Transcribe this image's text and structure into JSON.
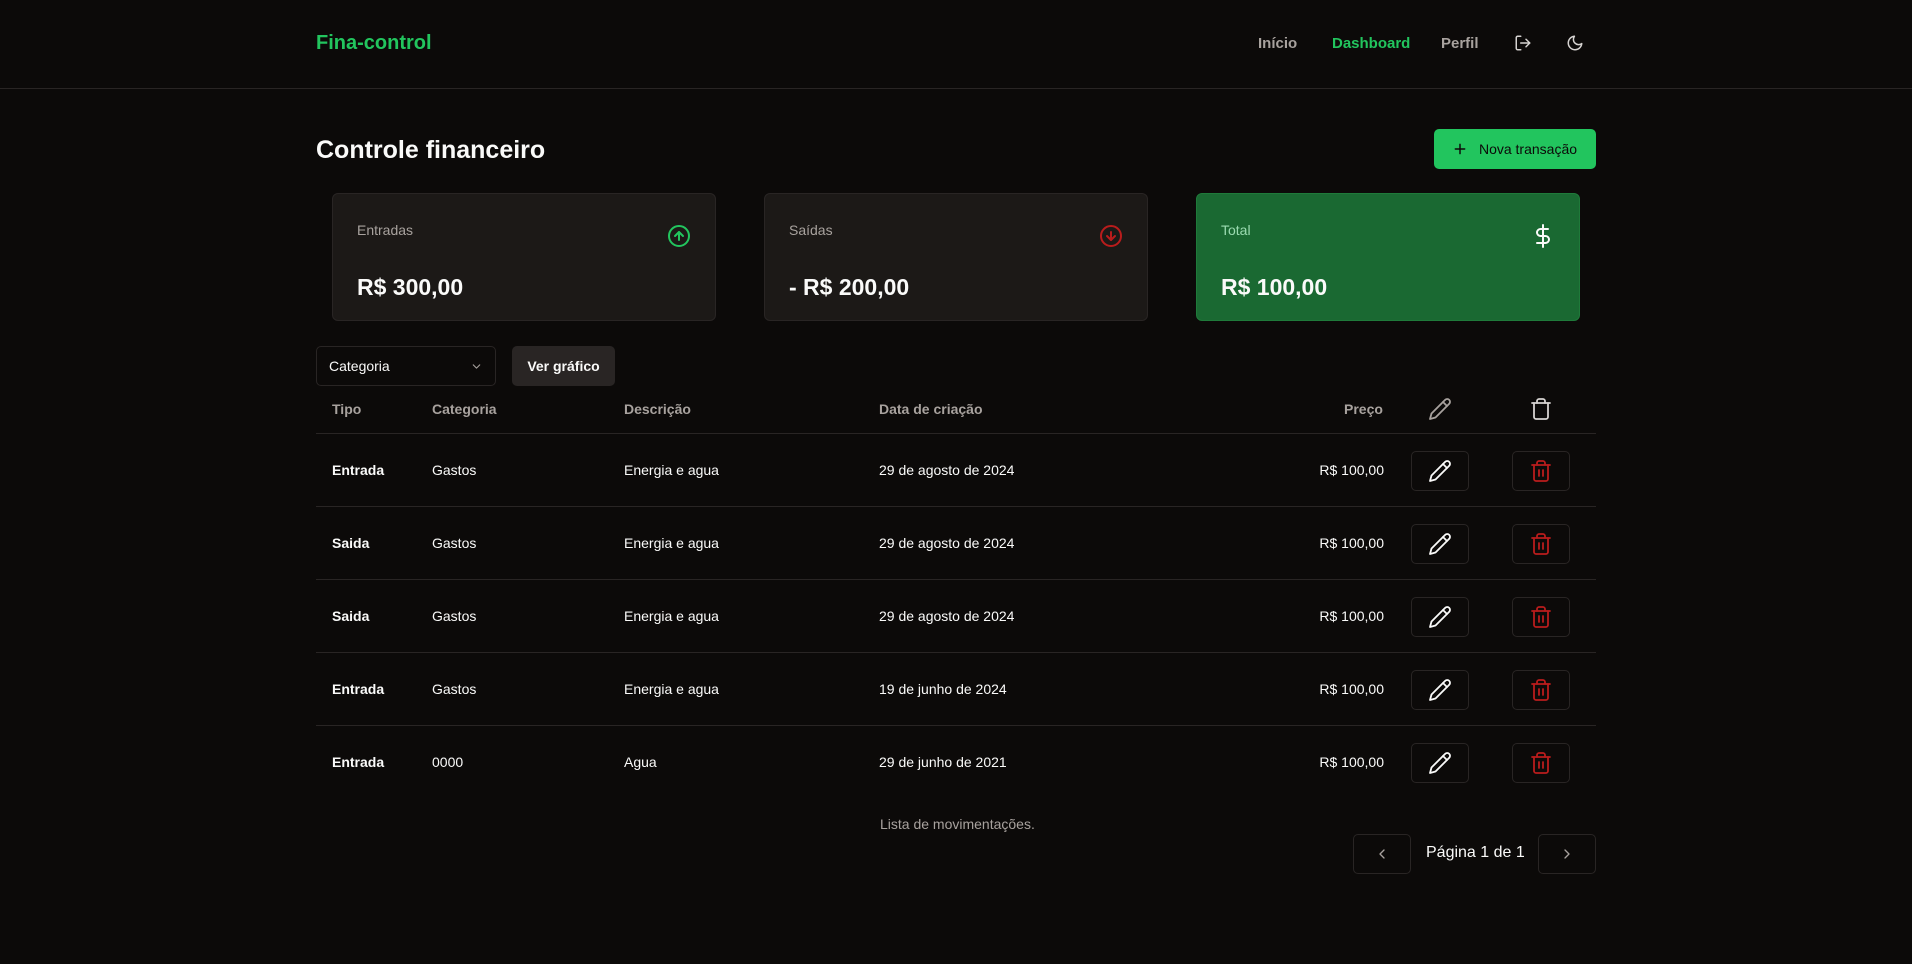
{
  "header": {
    "brand": "Fina-control",
    "nav": [
      {
        "label": "Início",
        "active": false
      },
      {
        "label": "Dashboard",
        "active": true
      },
      {
        "label": "Perfil",
        "active": false
      }
    ],
    "logout_icon": "logout-icon",
    "theme_icon": "moon-icon"
  },
  "main": {
    "title": "Controle financeiro",
    "new_button": "Nova transação",
    "cards": {
      "entradas": {
        "label": "Entradas",
        "value": "R$ 300,00",
        "icon": "arrow-up-circle-icon",
        "color": "#22c55e"
      },
      "saidas": {
        "label": "Saídas",
        "value": "- R$ 200,00",
        "icon": "arrow-down-circle-icon",
        "color": "#b91c1c"
      },
      "total": {
        "label": "Total",
        "value": "R$ 100,00",
        "icon": "dollar-icon",
        "color": "#1a6932"
      }
    },
    "filter": {
      "select_value": "Categoria",
      "chart_button": "Ver gráfico"
    },
    "table": {
      "headers": {
        "tipo": "Tipo",
        "categoria": "Categoria",
        "descricao": "Descrição",
        "data": "Data de criação",
        "preco": "Preço"
      },
      "rows": [
        {
          "tipo": "Entrada",
          "categoria": "Gastos",
          "descricao": "Energia e agua",
          "data": "29 de agosto de 2024",
          "preco": "R$ 100,00"
        },
        {
          "tipo": "Saida",
          "categoria": "Gastos",
          "descricao": "Energia e agua",
          "data": "29 de agosto de 2024",
          "preco": "R$ 100,00"
        },
        {
          "tipo": "Saida",
          "categoria": "Gastos",
          "descricao": "Energia e agua",
          "data": "29 de agosto de 2024",
          "preco": "R$ 100,00"
        },
        {
          "tipo": "Entrada",
          "categoria": "Gastos",
          "descricao": "Energia e agua",
          "data": "19 de junho de 2024",
          "preco": "R$ 100,00"
        },
        {
          "tipo": "Entrada",
          "categoria": "0000",
          "descricao": "Agua",
          "data": "29 de junho de 2021",
          "preco": "R$ 100,00"
        }
      ],
      "caption": "Lista de movimentações."
    },
    "pagination": {
      "text": "Página 1 de 1"
    }
  }
}
